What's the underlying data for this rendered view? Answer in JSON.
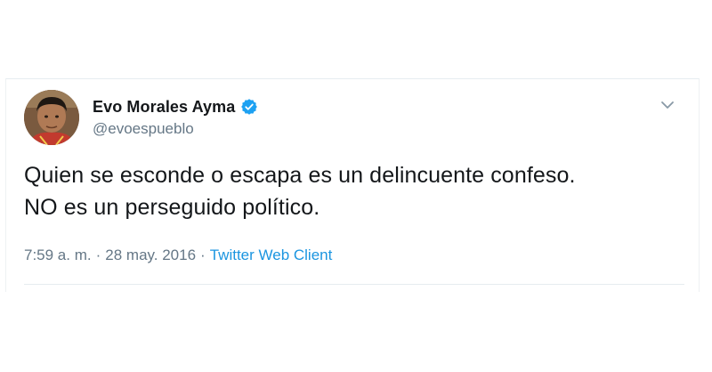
{
  "tweet": {
    "author": {
      "display_name": "Evo Morales Ayma",
      "handle": "@evoespueblo",
      "verified": true,
      "avatar_icon": "profile-photo"
    },
    "text_lines": [
      "Quien se esconde o escapa es un delincuente confeso.",
      "NO es un perseguido político."
    ],
    "time": "7:59 a. m.",
    "separator": "·",
    "date": "28 may. 2016",
    "source": "Twitter Web Client",
    "menu_icon": "chevron-down-icon"
  },
  "colors": {
    "text_primary": "#14171a",
    "text_secondary": "#657786",
    "link_blue": "#1b95e0",
    "verified_blue": "#1da1f2",
    "border": "#e6ecf0"
  }
}
